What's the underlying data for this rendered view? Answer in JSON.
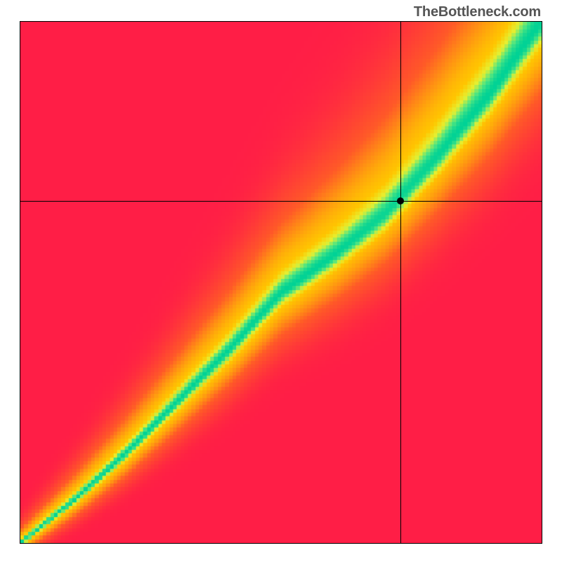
{
  "watermark": "TheBottleneck.com",
  "chart_data": {
    "type": "heatmap",
    "title": "",
    "xlabel": "",
    "ylabel": "",
    "xlim": [
      0,
      1
    ],
    "ylim": [
      0,
      1
    ],
    "grid": false,
    "legend": false,
    "crosshair": {
      "x": 0.727,
      "y": 0.657
    },
    "marker": {
      "x": 0.727,
      "y": 0.657
    },
    "description": "Red→yellow→green heatmap showing compatibility. A narrow green band follows a roughly diagonal curve from the bottom-left corner, steepening through the upper half of the plot. Red dominates the lower-right and upper-left corners; yellow/orange flanks the green ridge. A black crosshair with a dot marks the (CPU, GPU) point near the right edge of the green band.",
    "ridge_points": [
      {
        "x": 0.0,
        "y": 0.0
      },
      {
        "x": 0.1,
        "y": 0.08
      },
      {
        "x": 0.2,
        "y": 0.17
      },
      {
        "x": 0.3,
        "y": 0.27
      },
      {
        "x": 0.4,
        "y": 0.37
      },
      {
        "x": 0.5,
        "y": 0.48
      },
      {
        "x": 0.6,
        "y": 0.55
      },
      {
        "x": 0.7,
        "y": 0.63
      },
      {
        "x": 0.8,
        "y": 0.74
      },
      {
        "x": 0.9,
        "y": 0.86
      },
      {
        "x": 1.0,
        "y": 1.0
      }
    ]
  }
}
